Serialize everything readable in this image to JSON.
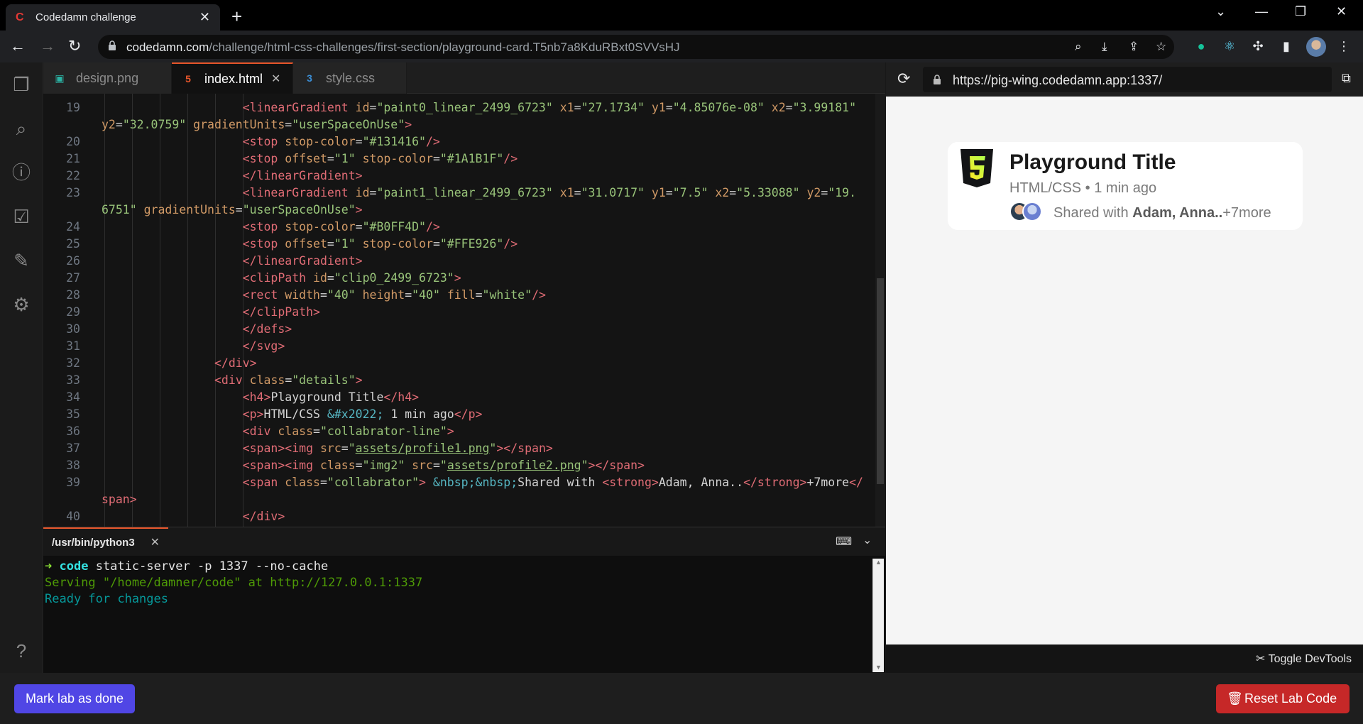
{
  "browser": {
    "tab_title": "Codedamn challenge",
    "url_host": "codedamn.com",
    "url_path": "/challenge/html-css-challenges/first-section/playground-card.T5nb7a8KduRBxt0SVVsHJ"
  },
  "editor": {
    "tabs": [
      {
        "label": "design.png",
        "icon": "image-icon"
      },
      {
        "label": "index.html",
        "icon": "html5-icon"
      },
      {
        "label": "style.css",
        "icon": "css3-icon"
      }
    ],
    "line_numbers": [
      "19",
      "",
      "20",
      "21",
      "22",
      "23",
      "",
      "24",
      "25",
      "26",
      "27",
      "28",
      "29",
      "30",
      "31",
      "32",
      "33",
      "34",
      "35",
      "36",
      "37",
      "38",
      "39",
      "",
      "40"
    ]
  },
  "terminal": {
    "tab_label": "/usr/bin/python3",
    "prompt_arrow": "➜",
    "cmd_name": "code",
    "cmd_args": "static-server -p 1337 --no-cache",
    "line2": "Serving \"/home/damner/code\" at http://127.0.0.1:1337",
    "line3": "Ready for changes"
  },
  "preview": {
    "url": "https://pig-wing.codedamn.app:1337/",
    "card_title": "Playground Title",
    "card_subtitle": "HTML/CSS • 1 min ago",
    "shared_prefix": "Shared with ",
    "shared_names": "Adam, Anna..",
    "shared_more": "+7more",
    "devtools_label": "Toggle DevTools"
  },
  "footer": {
    "mark_done": "Mark lab as done",
    "reset": "Reset Lab Code"
  },
  "colors": {
    "accent_purple": "#5046e5",
    "reset_red": "#c62828",
    "tab_accent": "#e8562b"
  }
}
